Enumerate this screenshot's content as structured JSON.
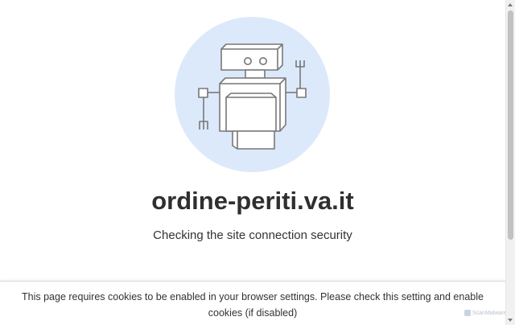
{
  "main": {
    "site_name": "ordine-periti.va.it",
    "status_text": "Checking the site connection security"
  },
  "cookie_notice": {
    "text": "This page requires cookies to be enabled in your browser settings. Please check this setting and enable cookies (if disabled)"
  },
  "badge": {
    "label": "ScanMalware"
  },
  "colors": {
    "illustration_circle": "#dce9fb",
    "robot_stroke": "#777777",
    "robot_fill": "#ffffff",
    "title_text": "#2f2f2f"
  },
  "icons": {
    "illustration": "robot-icon",
    "badge": "scanmalware-logo-icon"
  }
}
